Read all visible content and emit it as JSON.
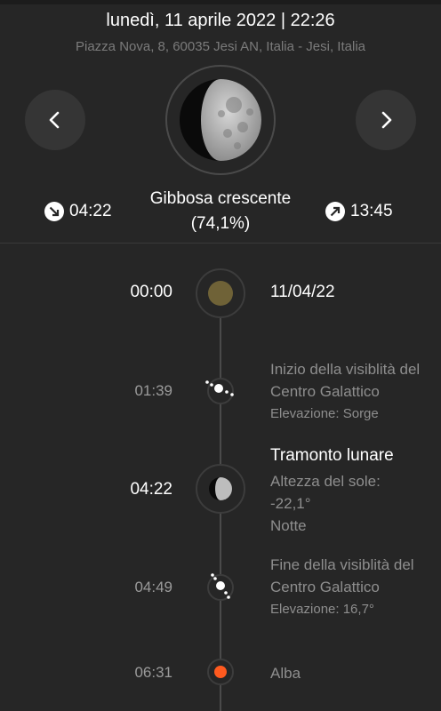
{
  "header": {
    "datetime": "lunedì, 11 aprile 2022 | 22:26",
    "location": "Piazza Nova, 8, 60035 Jesi AN, Italia - Jesi, Italia"
  },
  "moon": {
    "phase_name": "Gibbosa crescente",
    "illumination": "(74,1%)",
    "set_time": "04:22",
    "rise_time": "13:45"
  },
  "timeline": [
    {
      "time": "00:00",
      "date": "11/04/22"
    },
    {
      "time": "01:39",
      "title": "Inizio della visiblità del Centro Galattico",
      "detail": "Elevazione: Sorge"
    },
    {
      "time": "04:22",
      "title": "Tramonto lunare",
      "line1": "Altezza del sole:",
      "line2": "-22,1°",
      "line3": "Notte"
    },
    {
      "time": "04:49",
      "title": "Fine della visiblità del Centro Galattico",
      "detail": "Elevazione: 16,7°"
    },
    {
      "time": "06:31",
      "title": "Alba"
    }
  ],
  "colors": {
    "background": "#262626",
    "sunrise_dot": "#ff5a1f",
    "day_dot": "#6f6237",
    "muted_text": "#8e8e8e"
  }
}
